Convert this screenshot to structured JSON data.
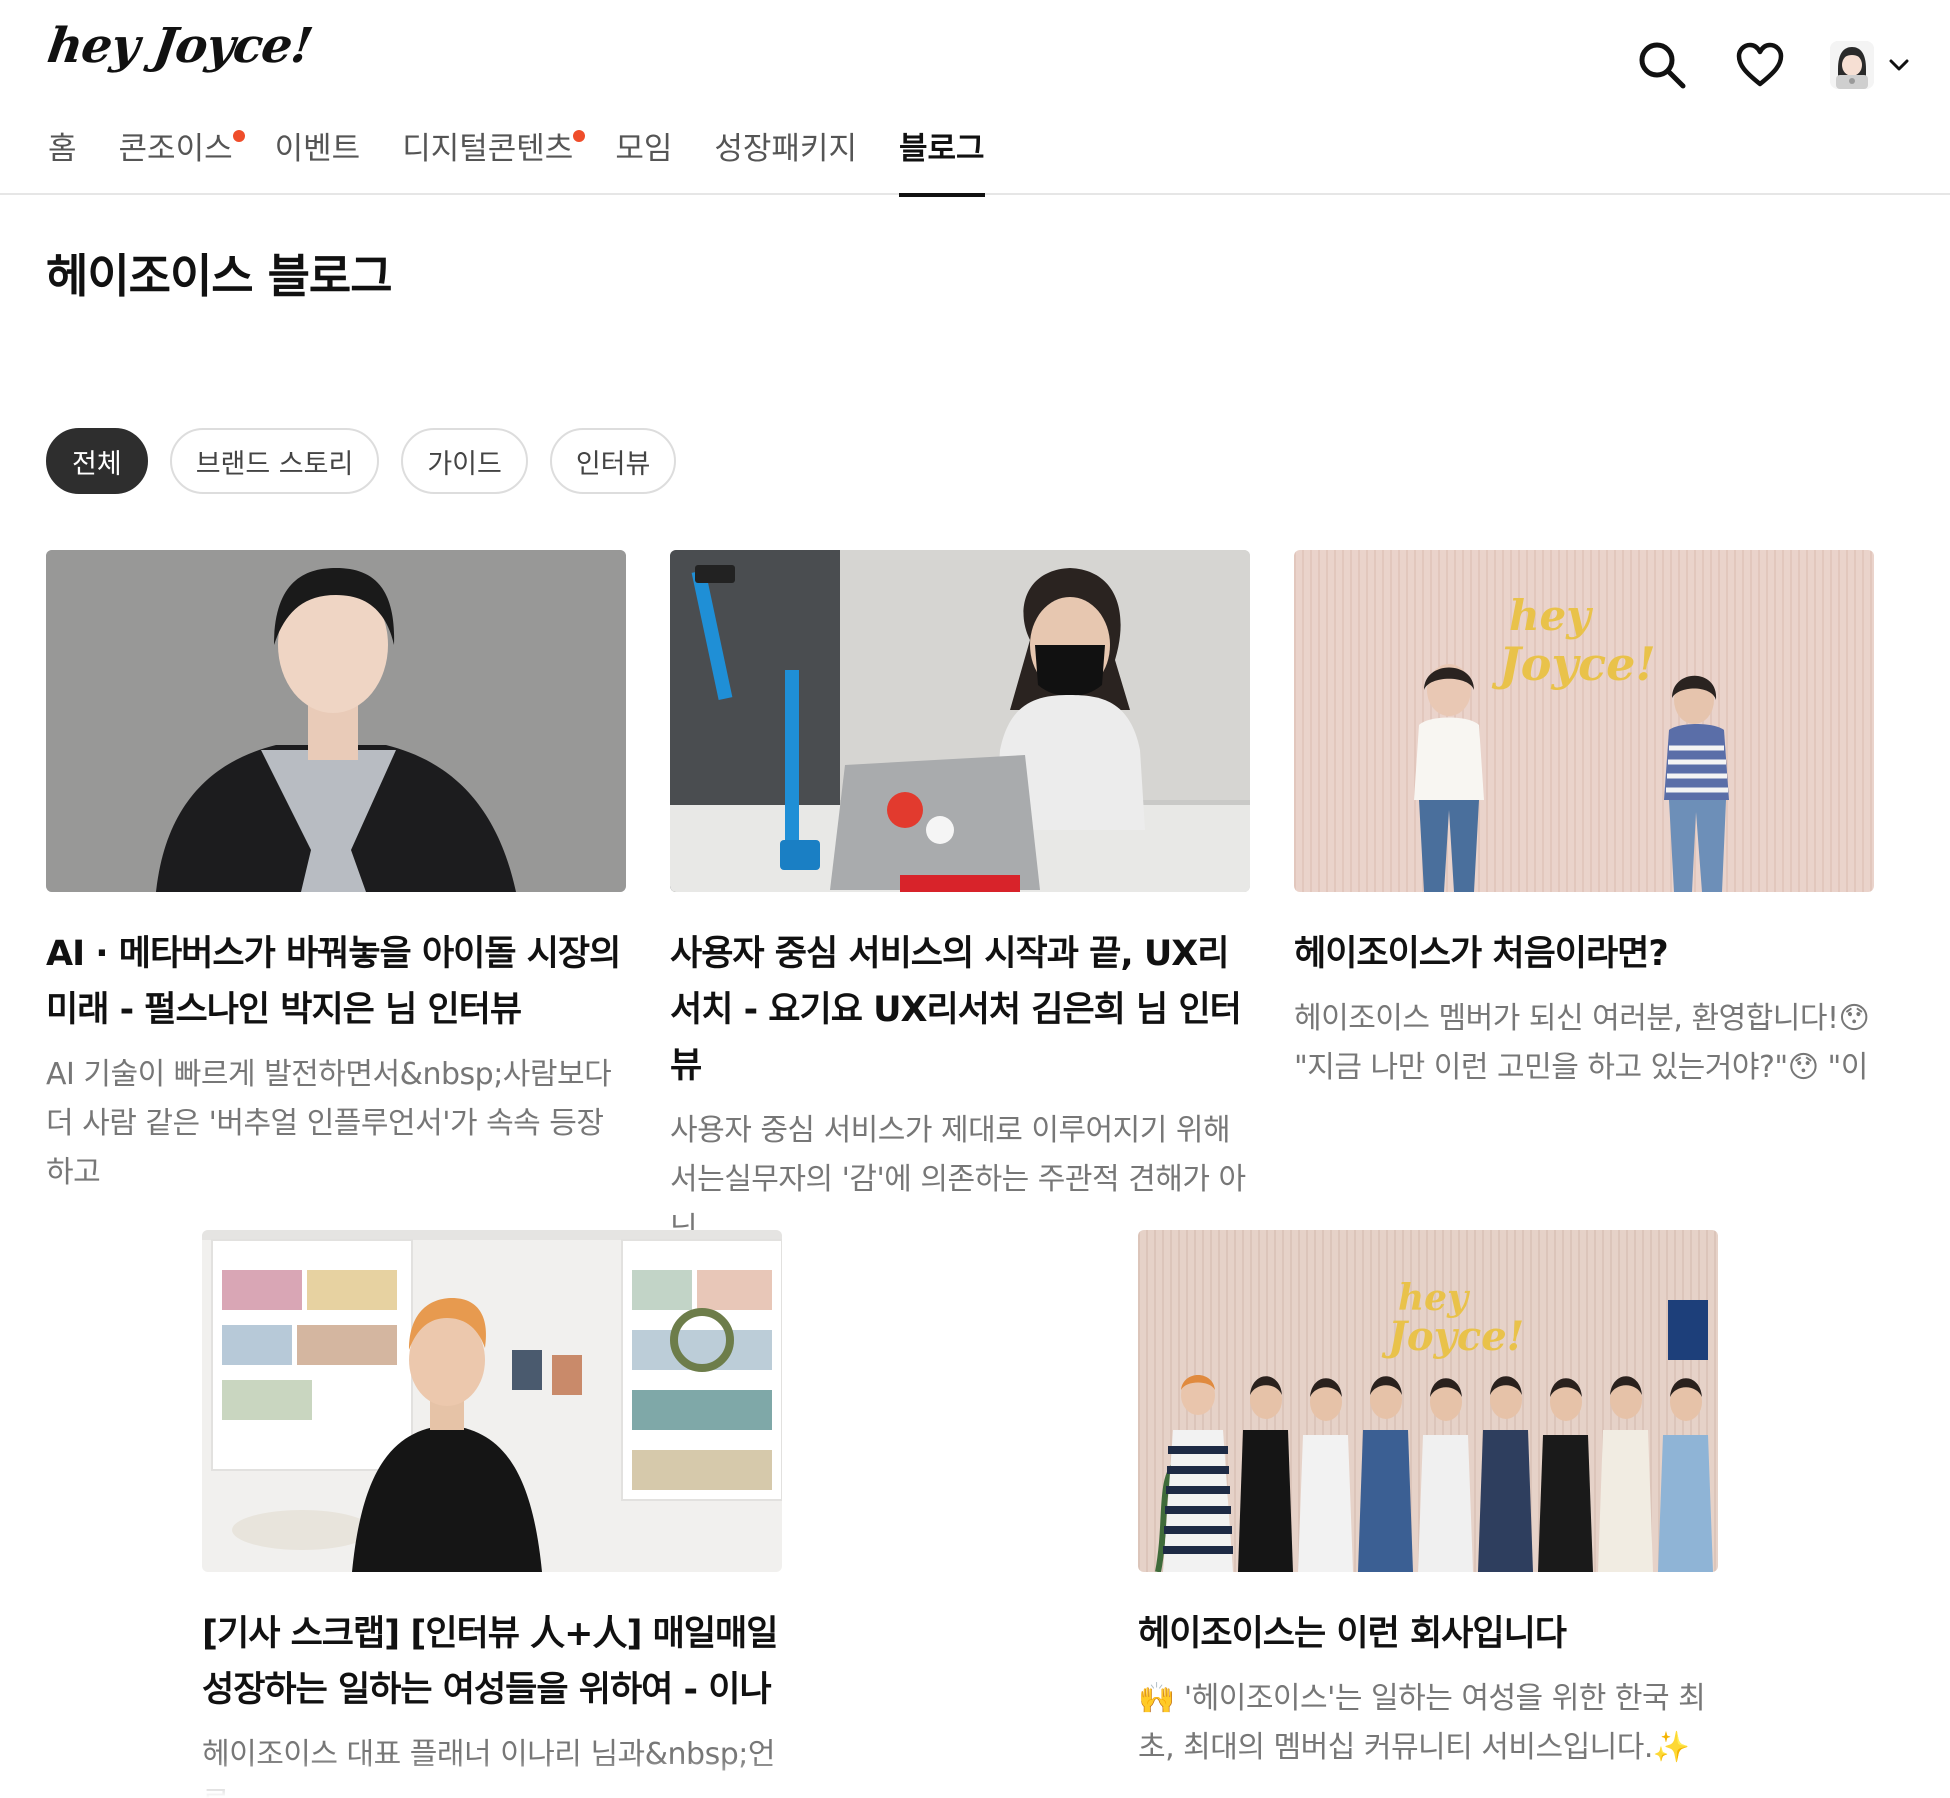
{
  "brand": {
    "logo_text": "hey Joyce!"
  },
  "header": {
    "icons": {
      "search": "search-icon",
      "wishlist": "heart-icon",
      "profile": "avatar",
      "menu": "chevron-down-icon"
    }
  },
  "nav": {
    "items": [
      {
        "label": "홈",
        "badge": false,
        "active": false
      },
      {
        "label": "콘조이스",
        "badge": true,
        "active": false
      },
      {
        "label": "이벤트",
        "badge": false,
        "active": false
      },
      {
        "label": "디지털콘텐츠",
        "badge": true,
        "active": false
      },
      {
        "label": "모임",
        "badge": false,
        "active": false
      },
      {
        "label": "성장패키지",
        "badge": false,
        "active": false
      },
      {
        "label": "블로그",
        "badge": false,
        "active": true
      }
    ]
  },
  "page": {
    "title": "헤이조이스 블로그"
  },
  "filters": [
    {
      "label": "전체",
      "active": true
    },
    {
      "label": "브랜드 스토리",
      "active": false
    },
    {
      "label": "가이드",
      "active": false
    },
    {
      "label": "인터뷰",
      "active": false
    }
  ],
  "posts": [
    {
      "title": "AI · 메타버스가 바꿔놓을 아이돌 시장의 미래 - 펄스나인 박지은 님 인터뷰",
      "excerpt": "AI 기술이 빠르게 발전하면서&nbsp;사람보다 더 사람 같은 '버추얼 인플루언서'가 속속 등장하고"
    },
    {
      "title": "사용자 중심 서비스의 시작과 끝, UX리서치 - 요기요 UX리서처 김은희 님 인터뷰",
      "excerpt": "사용자 중심 서비스가 제대로 이루어지기 위해서는실무자의 '감'에 의존하는 주관적 견해가 아닌"
    },
    {
      "title": "헤이조이스가 처음이라면?",
      "excerpt": "헤이조이스 멤버가 되신 여러분, 환영합니다!😯 \"지금 나만 이런 고민을 하고 있는거야?\"😯 \"이"
    },
    {
      "title": "[기사 스크랩] [인터뷰 人+人] 매일매일 성장하는 일하는 여성들을 위하여 - 이나",
      "excerpt": "헤이조이스 대표 플래너 이나리 님과&nbsp;언론"
    },
    {
      "title": "헤이조이스는 이런 회사입니다",
      "excerpt": "🙌 '헤이조이스'는 일하는 여성을 위한 한국 최초, 최대의 멤버십 커뮤니티 서비스입니다.✨"
    }
  ],
  "colors": {
    "accent_dot": "#ef4d2a",
    "chip_active_bg": "#2e2e2e",
    "text_muted": "#777777"
  }
}
